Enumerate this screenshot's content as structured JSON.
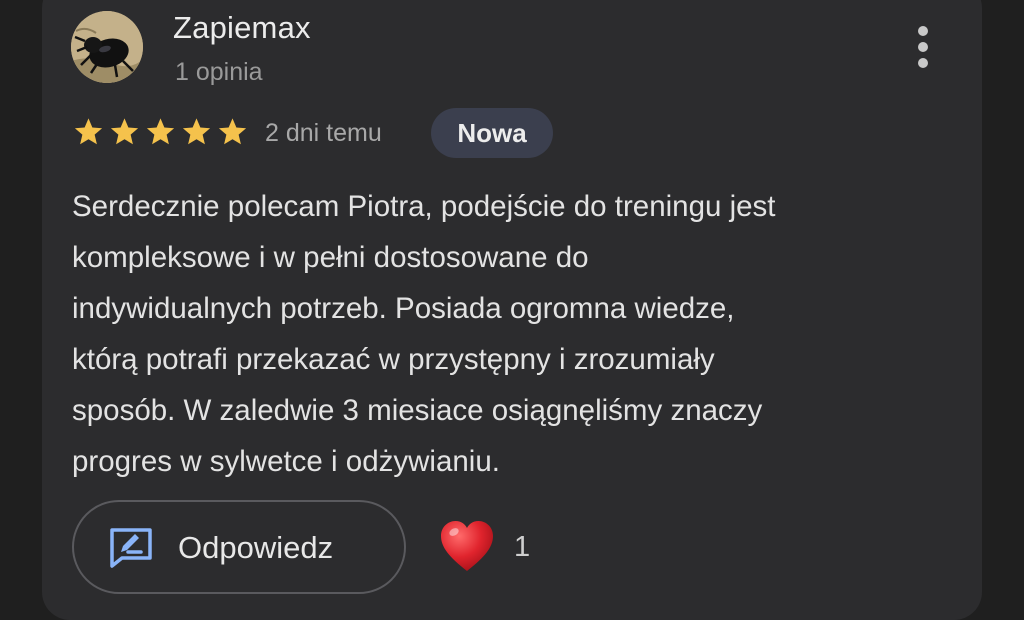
{
  "review": {
    "author": {
      "name": "Zapiemax",
      "subtitle": "1 opinia",
      "avatar_icon": "beetle-avatar"
    },
    "rating": {
      "stars": 5,
      "max": 5,
      "star_color": "#f5c24c"
    },
    "time_ago": "2 dni temu",
    "badge": "Nowa",
    "text": "Serdecznie polecam Piotra, podejście do treningu jest\nkompleksowe i w pełni dostosowane do\nindywidualnych potrzeb. Posiada ogromna wiedze,\nktórą potrafi przekazać w przystępny i zrozumiały\nsposób. W zaledwie 3 miesiace osiągnęliśmy znaczy\nprogres w sylwetce i odżywianiu.",
    "actions": {
      "reply_label": "Odpowiedz",
      "reply_icon": "reply-edit-icon",
      "reaction_icon": "red-heart-icon",
      "reaction_count": "1",
      "more_icon": "more-vertical-icon"
    }
  },
  "colors": {
    "background": "#1f1f1f",
    "card": "#2c2c2e",
    "badge_bg": "#3b3f4e",
    "accent_blue": "#8ab4f8",
    "heart": "#e0242d"
  }
}
